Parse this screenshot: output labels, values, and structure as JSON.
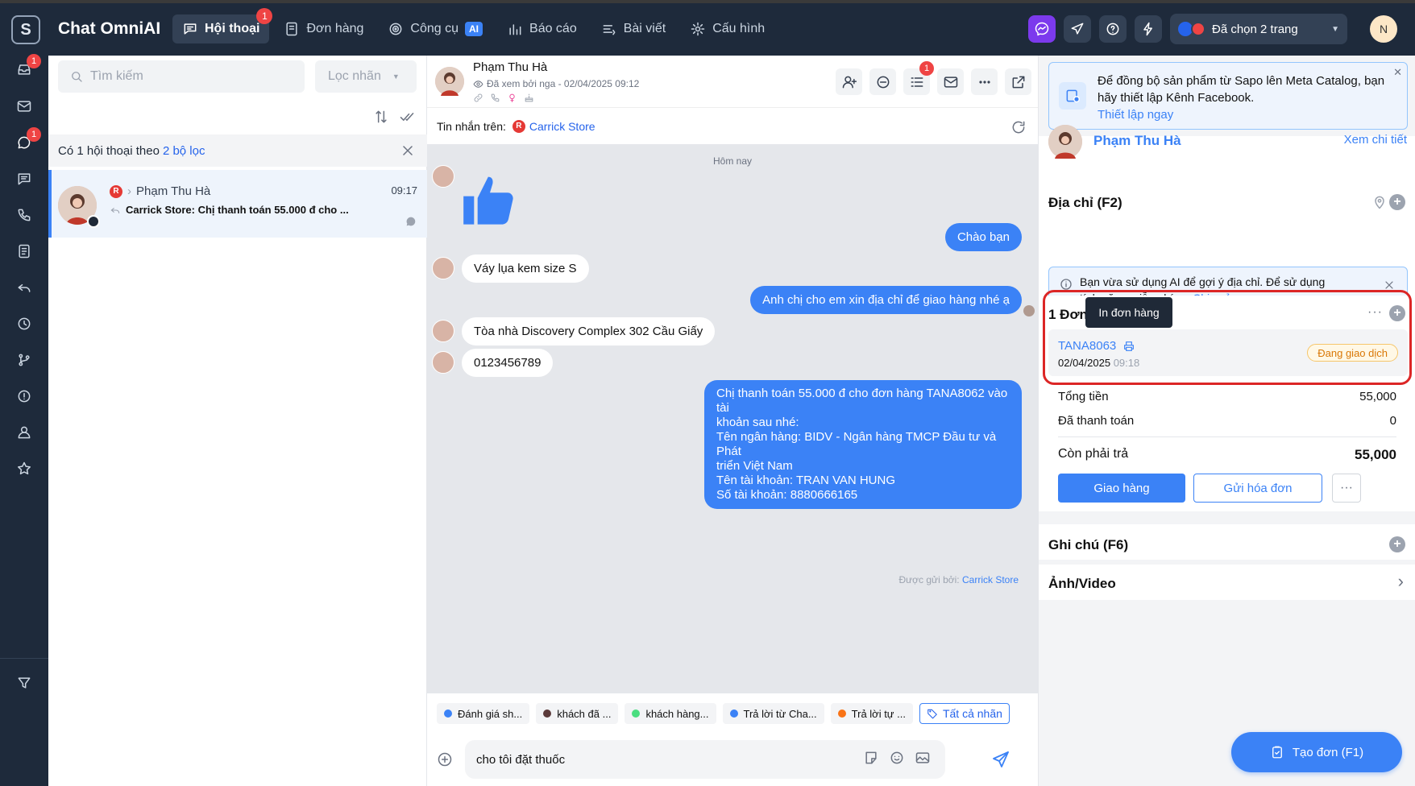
{
  "app": {
    "title": "Chat OmniAI",
    "logo_letter": "S"
  },
  "nav": {
    "items": [
      {
        "label": "Hội thoại",
        "badge": "1"
      },
      {
        "label": "Đơn hàng"
      },
      {
        "label": "Công cụ",
        "tag": "AI"
      },
      {
        "label": "Báo cáo"
      },
      {
        "label": "Bài viết"
      },
      {
        "label": "Cấu hình"
      }
    ]
  },
  "topbar": {
    "page_selector": "Đã chọn 2 trang",
    "avatar_letter": "N"
  },
  "rail": {
    "inbox_badge": "1",
    "chat_badge": "1"
  },
  "list": {
    "search_placeholder": "Tìm kiếm",
    "label_filter": "Lọc nhãn",
    "filter_text": "Có 1 hội thoại theo",
    "filter_link": "2 bộ lọc",
    "conversation": {
      "name": "Phạm Thu Hà",
      "time": "09:17",
      "preview": "Carrick Store: Chị thanh toán 55.000 đ cho ..."
    }
  },
  "chat": {
    "name": "Phạm Thu Hà",
    "seen": "Đã xem bởi nga - 02/04/2025 09:12",
    "tool_badge": "1",
    "source_label": "Tin nhắn trên:",
    "source_store": "Carrick Store",
    "day": "Hôm nay",
    "messages": {
      "out1": "Chào bạn",
      "in1": "Váy lụa kem size S",
      "out2": "Anh chị cho em xin địa chỉ để giao hàng nhé ạ",
      "in2": "Tòa nhà Discovery Complex 302 Cầu Giấy",
      "in3": "0123456789",
      "out3_lines": [
        "Chị thanh toán 55.000 đ cho đơn hàng TANA8062 vào tài",
        "khoản sau nhé:",
        "Tên ngân hàng: BIDV - Ngân hàng TMCP Đầu tư và Phát",
        "triển Việt Nam",
        "Tên tài khoản: TRAN VAN HUNG",
        "Số tài khoản: 8880666165"
      ]
    },
    "sent_by_label": "Được gửi bởi:",
    "sent_by_store": "Carrick Store",
    "tags": [
      {
        "label": "Đánh giá sh...",
        "color": "#3b82f6"
      },
      {
        "label": "khách đã ...",
        "color": "#5b3a3a"
      },
      {
        "label": "khách hàng...",
        "color": "#4ade80"
      },
      {
        "label": "Trả lời từ Cha...",
        "color": "#3b82f6"
      },
      {
        "label": "Trả lời tự ...",
        "color": "#f97316"
      }
    ],
    "all_tags": "Tất cả nhãn",
    "composer_text": "cho tôi đặt thuốc"
  },
  "panel": {
    "notice": "Để đồng bộ sản phẩm từ Sapo lên Meta Catalog, bạn hãy thiết lập Kênh Facebook.",
    "notice_link": "Thiết lập ngay",
    "customer_name": "Phạm Thu Hà",
    "view_detail": "Xem chi tiết",
    "address_title": "Địa chỉ (F2)",
    "ai_note_text": "Bạn vừa sử dụng AI để gợi ý địa chỉ. Để sử dụng tính năng miễn phí -",
    "ai_note_link": "Chia sẻ ngay",
    "orders_title": "1 Đơn",
    "tooltip": "In đơn hàng",
    "order": {
      "code": "TANA8063",
      "date": "02/04/2025",
      "time": "09:18",
      "status": "Đang giao dịch"
    },
    "total_label": "Tổng tiền",
    "total_value": "55,000",
    "paid_label": "Đã thanh toán",
    "paid_value": "0",
    "remain_label": "Còn phải trả",
    "remain_value": "55,000",
    "ship_button": "Giao hàng",
    "invoice_button": "Gửi hóa đơn",
    "note_title": "Ghi chú  (F6)",
    "media_title": "Ảnh/Video",
    "create_button": "Tạo đơn (F1)"
  }
}
